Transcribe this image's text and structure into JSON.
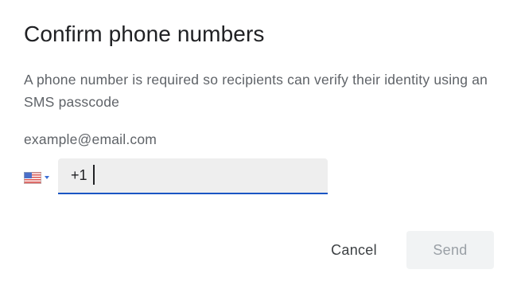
{
  "dialog": {
    "title": "Confirm phone numbers",
    "description": "A phone number is required so recipients can verify their identity using an SMS passcode"
  },
  "recipient": {
    "email": "example@email.com",
    "country_flag": "us-flag-icon",
    "phone_value": "+1"
  },
  "actions": {
    "cancel_label": "Cancel",
    "send_label": "Send",
    "send_enabled": false
  },
  "colors": {
    "field_underline": "#1a56c4",
    "field_background": "#eeeeee",
    "disabled_button_bg": "#f1f3f4",
    "disabled_button_text": "#9aa0a6"
  }
}
